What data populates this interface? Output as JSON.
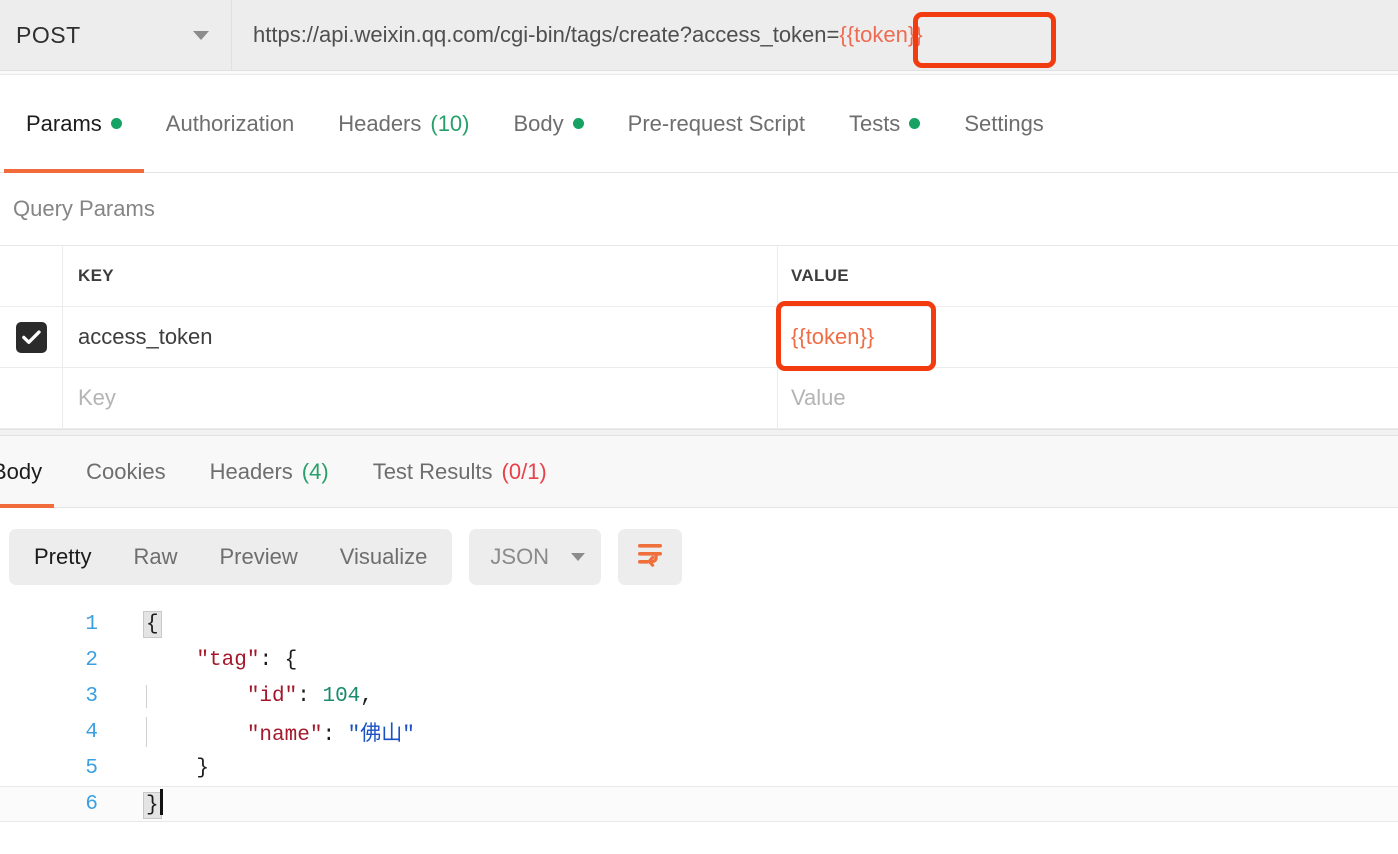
{
  "request": {
    "method": "POST",
    "method_caret_icon": "chevron-down-icon",
    "url_prefix": "https://api.weixin.qq.com/cgi-bin/tags/create?access_token=",
    "url_variable": "{{token}}"
  },
  "request_tabs": [
    {
      "label": "Params",
      "indicator": "dot",
      "active": true
    },
    {
      "label": "Authorization",
      "indicator": "none",
      "active": false
    },
    {
      "label": "Headers",
      "count": "(10)",
      "indicator": "count",
      "active": false
    },
    {
      "label": "Body",
      "indicator": "dot",
      "active": false
    },
    {
      "label": "Pre-request Script",
      "indicator": "none",
      "active": false
    },
    {
      "label": "Tests",
      "indicator": "dot",
      "active": false
    },
    {
      "label": "Settings",
      "indicator": "none",
      "active": false
    }
  ],
  "params": {
    "section_title": "Query Params",
    "columns": {
      "key": "KEY",
      "value": "VALUE"
    },
    "rows": [
      {
        "checked": true,
        "key": "access_token",
        "value": "{{token}}",
        "is_variable": true
      },
      {
        "checked": false,
        "key_placeholder": "Key",
        "value_placeholder": "Value",
        "is_variable": false
      }
    ]
  },
  "response_tabs": [
    {
      "label": "Body",
      "indicator": "none",
      "active": true
    },
    {
      "label": "Cookies",
      "indicator": "none",
      "active": false
    },
    {
      "label": "Headers",
      "count": "(4)",
      "indicator": "count-green",
      "active": false
    },
    {
      "label": "Test Results",
      "count": "(0/1)",
      "indicator": "count-red",
      "active": false
    }
  ],
  "view_toolbar": {
    "segments": [
      {
        "label": "Pretty",
        "active": true
      },
      {
        "label": "Raw",
        "active": false
      },
      {
        "label": "Preview",
        "active": false
      },
      {
        "label": "Visualize",
        "active": false
      }
    ],
    "format": "JSON",
    "format_caret_icon": "chevron-down-icon",
    "wrap_icon": "word-wrap-icon"
  },
  "response_body": {
    "language": "json",
    "lines": [
      {
        "num": "1",
        "text": "{"
      },
      {
        "num": "2",
        "text": "    \"tag\": {"
      },
      {
        "num": "3",
        "text": "        \"id\": 104,"
      },
      {
        "num": "4",
        "text": "        \"name\": \"佛山\""
      },
      {
        "num": "5",
        "text": "    }"
      },
      {
        "num": "6",
        "text": "}"
      }
    ],
    "tokens": {
      "line2_key": "\"tag\"",
      "line2_rest": ": {",
      "line3_key": "\"id\"",
      "line3_colon": ": ",
      "line3_num": "104",
      "line3_comma": ",",
      "line4_key": "\"name\"",
      "line4_colon": ": ",
      "line4_str": "\"佛山\"",
      "line5_brace": "}",
      "line1_brace": "{",
      "line6_brace": "}"
    }
  },
  "annotations": [
    {
      "name": "url-token-highlight",
      "color": "#f23c10"
    },
    {
      "name": "value-token-highlight",
      "color": "#f23c10"
    }
  ],
  "colors": {
    "accent_orange": "#f26b3a",
    "annotation_red": "#f23c10",
    "variable_orange": "#ef6d45",
    "green": "#16a263",
    "red": "#e8414a"
  }
}
